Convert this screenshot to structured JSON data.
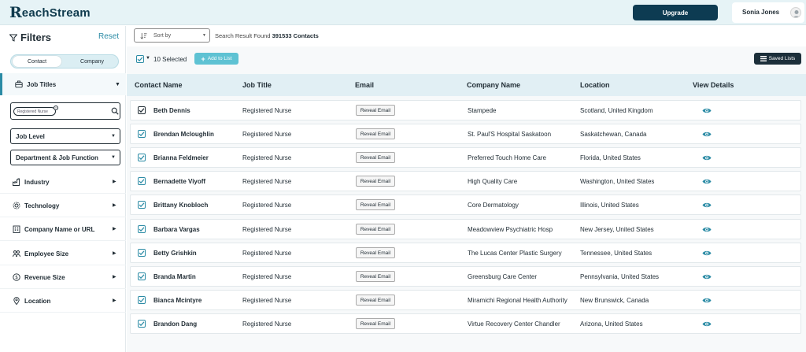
{
  "header": {
    "logo_initial": "R",
    "logo_text": "eachStream",
    "upgrade_label": "Upgrade",
    "user_name": "Sonia Jones"
  },
  "sidebar": {
    "title": "Filters",
    "reset_label": "Reset",
    "toggle": {
      "contact": "Contact",
      "company": "Company"
    },
    "job_titles_label": "Job Titles",
    "search_pill": "Registered Nurse",
    "job_level_label": "Job Level",
    "department_label": "Department & Job Function",
    "items": [
      {
        "label": "Industry",
        "icon": "industry-icon"
      },
      {
        "label": "Technology",
        "icon": "technology-icon"
      },
      {
        "label": "Company Name or URL",
        "icon": "building-icon"
      },
      {
        "label": "Employee Size",
        "icon": "employees-icon"
      },
      {
        "label": "Revenue Size",
        "icon": "revenue-icon"
      },
      {
        "label": "Location",
        "icon": "location-pin-icon"
      }
    ]
  },
  "toolbar": {
    "sort_placeholder": "Sort by",
    "result_prefix": "Search Result Found",
    "result_count": "391533 Contacts",
    "selected_label": "10 Selected",
    "add_to_list_label": "Add to List",
    "saved_lists_label": "Saved Lists"
  },
  "table": {
    "columns": [
      "Contact Name",
      "Job Title",
      "Email",
      "Company Name",
      "Location",
      "View Details"
    ],
    "reveal_label": "Reveal Email",
    "rows": [
      {
        "name": "Beth Dennis",
        "title": "Registered Nurse",
        "company": "Stampede",
        "location": "Scotland, United Kingdom"
      },
      {
        "name": "Brendan Mcloughlin",
        "title": "Registered Nurse",
        "company": "St. Paul'S Hospital Saskatoon",
        "location": "Saskatchewan, Canada"
      },
      {
        "name": "Brianna Feldmeier",
        "title": "Registered Nurse",
        "company": "Preferred Touch Home Care",
        "location": "Florida, United States"
      },
      {
        "name": "Bernadette Viyoff",
        "title": "Registered Nurse",
        "company": "High Quality Care",
        "location": "Washington, United States"
      },
      {
        "name": "Brittany Knobloch",
        "title": "Registered Nurse",
        "company": "Core Dermatology",
        "location": "Illinois, United States"
      },
      {
        "name": "Barbara Vargas",
        "title": "Registered Nurse",
        "company": "Meadowview Psychiatric Hosp",
        "location": "New Jersey, United States"
      },
      {
        "name": "Betty Grishkin",
        "title": "Registered Nurse",
        "company": "The Lucas Center Plastic Surgery",
        "location": "Tennessee, United States"
      },
      {
        "name": "Branda Martin",
        "title": "Registered Nurse",
        "company": "Greensburg Care Center",
        "location": "Pennsylvania, United States"
      },
      {
        "name": "Bianca Mcintyre",
        "title": "Registered Nurse",
        "company": "Miramichi Regional Health Authority",
        "location": "New Brunswick, Canada"
      },
      {
        "name": "Brandon Dang",
        "title": "Registered Nurse",
        "company": "Virtue Recovery Center Chandler",
        "location": "Arizona, United States"
      }
    ]
  },
  "colors": {
    "brand_dark": "#0d3b52",
    "accent_teal": "#2b8ba5",
    "header_bg": "#e6f3f6",
    "table_header_bg": "#e1eff4",
    "add_button": "#5ec2d3"
  }
}
